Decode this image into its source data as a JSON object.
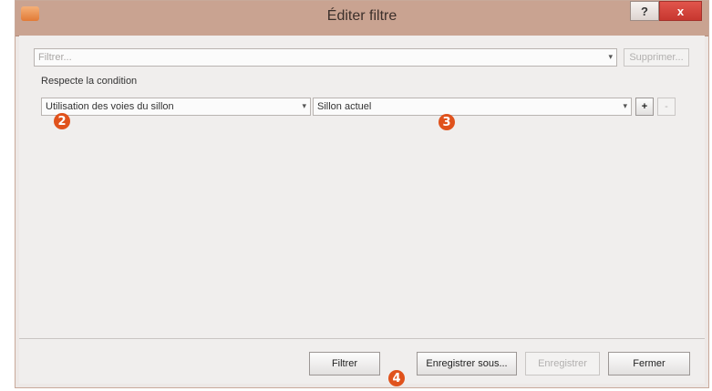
{
  "window": {
    "title": "Éditer filtre",
    "help_label": "?",
    "close_label": "x"
  },
  "filter_bar": {
    "placeholder": "Filtrer...",
    "dropdown_arrow": "▾",
    "delete_label": "Supprimer..."
  },
  "condition": {
    "label": "Respecte la condition",
    "field_value": "Utilisation des voies du sillon",
    "operator_value": "Sillon actuel",
    "add_label": "+",
    "remove_label": "-"
  },
  "footer": {
    "filter_label": "Filtrer",
    "save_as_label": "Enregistrer sous...",
    "save_label": "Enregistrer",
    "close_label": "Fermer"
  },
  "annotations": {
    "badge_2": "2",
    "badge_3": "3",
    "badge_4": "4"
  },
  "colors": {
    "title_bar": "#c9a391",
    "close_button": "#c7372f",
    "badge": "#e0521c"
  }
}
